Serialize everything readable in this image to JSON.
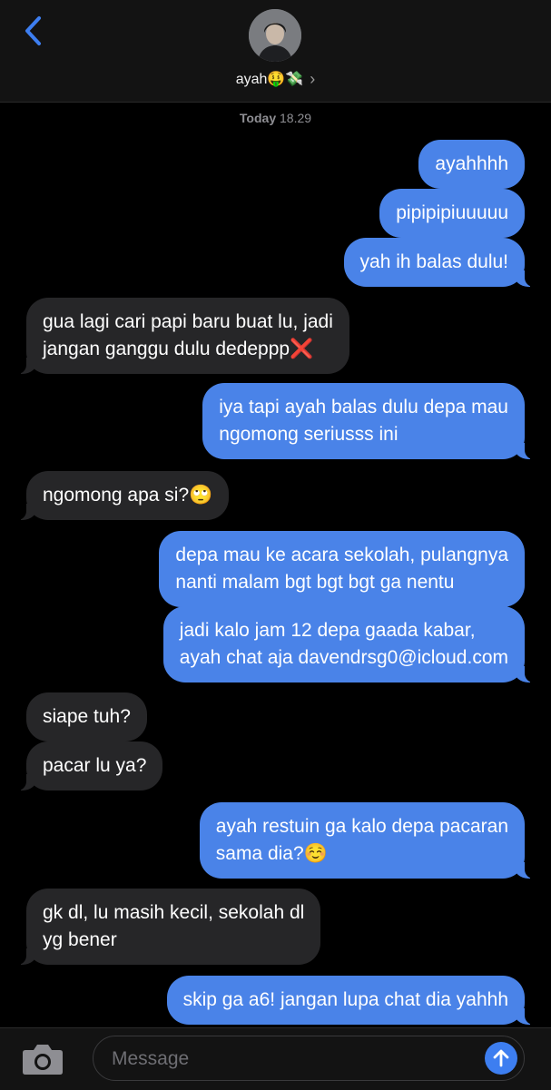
{
  "header": {
    "contact_name": "ayah🤑💸",
    "chevron": "›"
  },
  "timestamp": {
    "day": "Today",
    "time": "18.29"
  },
  "messages": [
    {
      "from": "me",
      "text": "ayahhhh"
    },
    {
      "from": "me",
      "text": "pipipipiuuuuu"
    },
    {
      "from": "me",
      "text": "yah ih balas dulu!"
    },
    {
      "from": "them",
      "lines": [
        "gua lagi cari papi baru buat lu, jadi",
        "jangan ganggu dulu dedeppp❌"
      ]
    },
    {
      "from": "me",
      "lines": [
        "iya tapi ayah balas dulu depa mau",
        "ngomong seriusss ini"
      ]
    },
    {
      "from": "them",
      "text": "ngomong apa si?🙄"
    },
    {
      "from": "me",
      "lines": [
        "depa mau ke acara sekolah, pulangnya",
        "nanti malam bgt bgt bgt ga nentu"
      ]
    },
    {
      "from": "me",
      "lines": [
        "jadi kalo jam 12 depa gaada kabar,",
        "ayah chat aja davendrsg0@icloud.com"
      ]
    },
    {
      "from": "them",
      "text": "siape tuh?"
    },
    {
      "from": "them",
      "text": "pacar lu ya?"
    },
    {
      "from": "me",
      "lines": [
        "ayah restuin ga kalo depa pacaran",
        "sama dia?☺️"
      ]
    },
    {
      "from": "them",
      "lines": [
        "gk dl, lu masih kecil, sekolah dl",
        "yg bener"
      ]
    },
    {
      "from": "me",
      "text": "skip ga a6! jangan lupa chat dia yahhh"
    }
  ],
  "composer": {
    "placeholder": "Message"
  },
  "icons": {
    "back": "chevron-left-icon",
    "camera": "camera-icon",
    "send": "arrow-up-icon"
  },
  "colors": {
    "outgoing_bubble": "#4a83e8",
    "incoming_bubble": "#262628",
    "accent": "#3d7ef0",
    "background": "#000000"
  }
}
